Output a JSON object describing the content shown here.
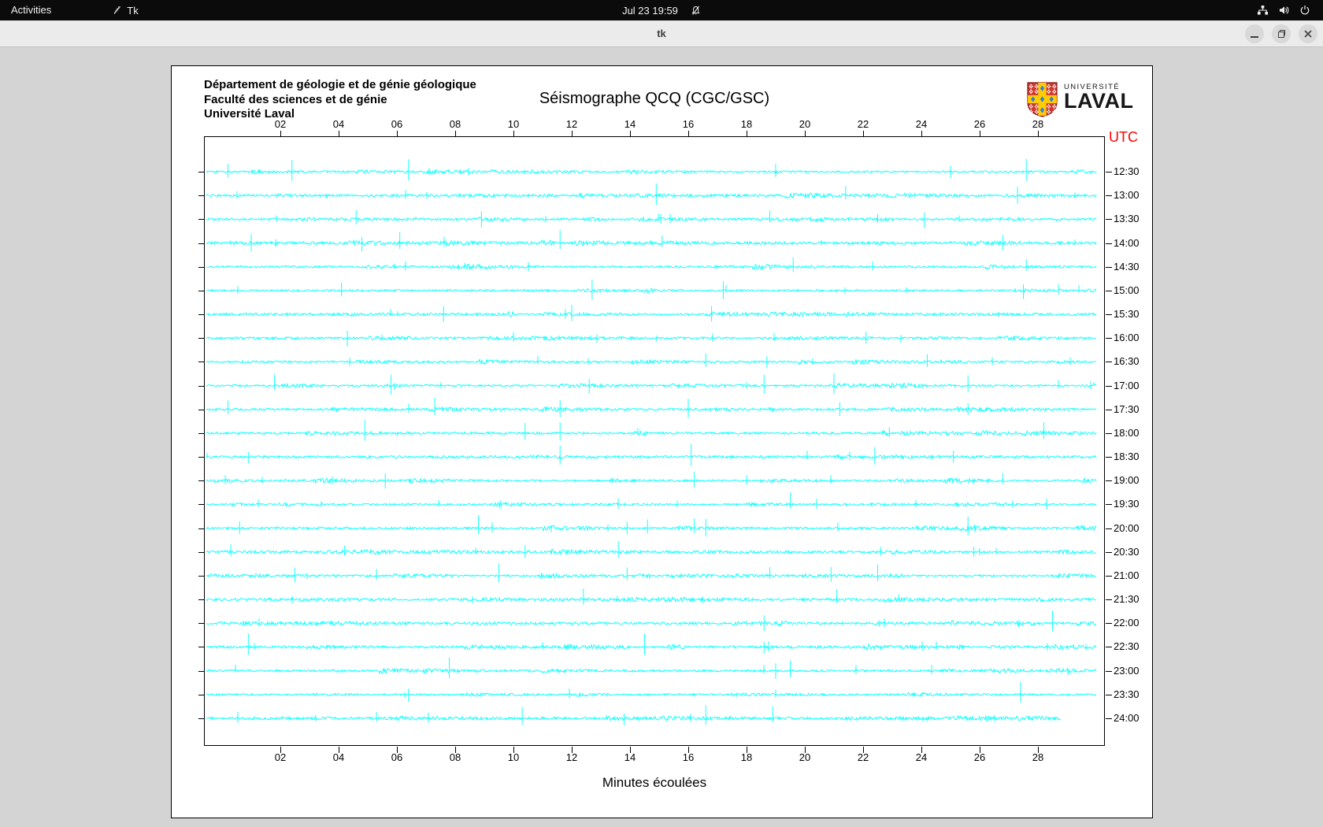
{
  "top_bar": {
    "activities_label": "Activities",
    "app_name": "Tk",
    "clock": "Jul 23 19:59",
    "status_icons": [
      "network-icon",
      "volume-icon",
      "power-icon"
    ]
  },
  "window": {
    "title": "tk",
    "controls": [
      "minimize",
      "restore",
      "close"
    ]
  },
  "canvas": {
    "header_lines": [
      "Département de géologie et de génie géologique",
      "Faculté des sciences et de génie",
      "Université Laval"
    ],
    "title": "Séismographe QCQ (CGC/GSC)",
    "logo": {
      "line1": "UNIVERSITÉ",
      "line2": "LAVAL",
      "red": "#d0392f",
      "yellow": "#ffcb05",
      "blue": "#2e7fd6"
    },
    "utc_label": "UTC",
    "utc_color": "#ff0000",
    "xlabel": "Minutes écoulées",
    "x_ticks": [
      "02",
      "04",
      "06",
      "08",
      "10",
      "12",
      "14",
      "16",
      "18",
      "20",
      "22",
      "24",
      "26",
      "28"
    ]
  },
  "chart_data": {
    "type": "line",
    "title": "Séismographe QCQ (CGC/GSC)",
    "xlabel": "Minutes écoulées",
    "x_axis": {
      "range_minutes": [
        0,
        30
      ],
      "ticks": [
        2,
        4,
        6,
        8,
        10,
        12,
        14,
        16,
        18,
        20,
        22,
        24,
        26,
        28
      ]
    },
    "y_axis": {
      "side": "right",
      "label": "UTC"
    },
    "trace_color": "#00ffff",
    "description": "Helicorder: 24 half-hour rows of continuous seismic background noise with intermittent transient spikes",
    "rows": [
      {
        "utc": "12:30",
        "spikes_min": [
          0.2,
          2.4,
          6.4,
          19.0,
          25.0,
          27.6
        ],
        "end_min": 30
      },
      {
        "utc": "13:00",
        "spikes_min": [
          6.3,
          14.9,
          21.4,
          27.3
        ],
        "end_min": 30
      },
      {
        "utc": "13:30",
        "spikes_min": [
          4.6,
          8.9,
          18.8,
          22.5,
          24.1
        ],
        "end_min": 30
      },
      {
        "utc": "14:00",
        "spikes_min": [
          1.0,
          4.8,
          6.1,
          11.6,
          15.1,
          26.8
        ],
        "end_min": 30
      },
      {
        "utc": "14:30",
        "spikes_min": [
          19.6,
          27.6
        ],
        "end_min": 30
      },
      {
        "utc": "15:00",
        "spikes_min": [
          4.1,
          12.7,
          17.2,
          27.5
        ],
        "end_min": 30
      },
      {
        "utc": "15:30",
        "spikes_min": [
          7.6,
          12.0,
          16.8
        ],
        "end_min": 30
      },
      {
        "utc": "16:00",
        "spikes_min": [
          4.3,
          10.0,
          22.1
        ],
        "end_min": 30
      },
      {
        "utc": "16:30",
        "spikes_min": [
          16.6,
          18.7,
          24.2
        ],
        "end_min": 30
      },
      {
        "utc": "17:00",
        "spikes_min": [
          1.8,
          5.8,
          12.6,
          18.6,
          21.0,
          25.6
        ],
        "end_min": 30
      },
      {
        "utc": "17:30",
        "spikes_min": [
          0.2,
          7.3,
          11.6,
          16.0,
          21.2,
          25.6
        ],
        "end_min": 30
      },
      {
        "utc": "18:00",
        "spikes_min": [
          4.9,
          10.4,
          11.6,
          22.9,
          28.2
        ],
        "end_min": 30
      },
      {
        "utc": "18:30",
        "spikes_min": [
          0.9,
          11.6,
          16.1,
          22.4,
          25.1
        ],
        "end_min": 30
      },
      {
        "utc": "19:00",
        "spikes_min": [
          5.6,
          16.2,
          26.8
        ],
        "end_min": 30
      },
      {
        "utc": "19:30",
        "spikes_min": [
          19.5,
          28.3
        ],
        "end_min": 30
      },
      {
        "utc": "20:00",
        "spikes_min": [
          0.6,
          8.8,
          13.9,
          14.6,
          16.2,
          16.6,
          25.6
        ],
        "end_min": 30
      },
      {
        "utc": "20:30",
        "spikes_min": [
          0.3,
          4.2,
          10.4,
          13.6,
          22.6,
          25.8
        ],
        "end_min": 30
      },
      {
        "utc": "21:00",
        "spikes_min": [
          2.5,
          5.3,
          9.5,
          13.9,
          18.8,
          20.9,
          22.5
        ],
        "end_min": 30
      },
      {
        "utc": "21:30",
        "spikes_min": [
          12.4,
          21.1
        ],
        "end_min": 30
      },
      {
        "utc": "22:00",
        "spikes_min": [
          18.6,
          28.5
        ],
        "end_min": 30
      },
      {
        "utc": "22:30",
        "spikes_min": [
          0.9,
          14.5,
          18.6
        ],
        "end_min": 30
      },
      {
        "utc": "23:00",
        "spikes_min": [
          7.8,
          19.0,
          19.5
        ],
        "end_min": 30
      },
      {
        "utc": "23:30",
        "spikes_min": [
          6.4,
          27.4
        ],
        "end_min": 30
      },
      {
        "utc": "24:00",
        "spikes_min": [
          5.3,
          10.3,
          13.8,
          16.6,
          18.9
        ],
        "end_min": 28.8
      }
    ]
  }
}
